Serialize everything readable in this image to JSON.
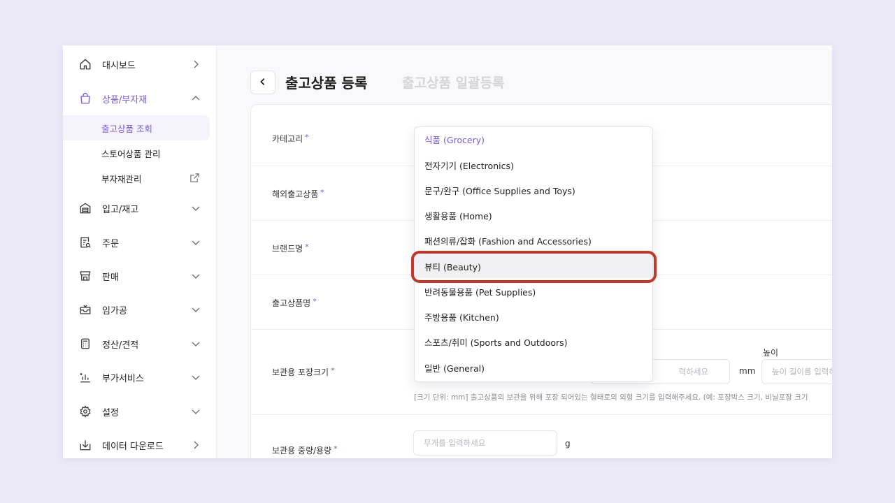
{
  "sidebar": {
    "items": [
      {
        "label": "대시보드"
      },
      {
        "label": "상품/부자재"
      },
      {
        "label": "입고/재고"
      },
      {
        "label": "주문"
      },
      {
        "label": "판매"
      },
      {
        "label": "임가공"
      },
      {
        "label": "정산/견적"
      },
      {
        "label": "부가서비스"
      },
      {
        "label": "설정"
      },
      {
        "label": "데이터 다운로드"
      }
    ],
    "sub_items": [
      {
        "label": "출고상품 조회"
      },
      {
        "label": "스토어상품 관리"
      },
      {
        "label": "부자재관리"
      }
    ]
  },
  "header": {
    "tab_active": "출고상품 등록",
    "tab_inactive": "출고상품 일괄등록"
  },
  "form": {
    "required_mark": "*",
    "category_label": "카테고리",
    "overseas_label": "해외출고상품",
    "brand_label": "브랜드명",
    "product_name_label": "출고상품명",
    "package_size_label": "보관용 포장크기",
    "height_label": "높이",
    "width_placeholder": "력하세요",
    "height_placeholder": "높이 길이를 입력하",
    "unit_mm": "mm",
    "size_hint": "[크기 단위: mm] 출고상품의 보관을 위해 포장 되어있는 형태로의 외형 크기를 입력해주세요. (예: 포장박스 크기, 비닐포장 크기",
    "weight_label": "보관용 중량/용량",
    "weight_placeholder": "무게를 입력하세요",
    "unit_g": "g"
  },
  "dropdown": {
    "options": [
      {
        "label": "식품 (Grocery)"
      },
      {
        "label": "전자기기 (Electronics)"
      },
      {
        "label": "문구/완구 (Office Supplies and Toys)"
      },
      {
        "label": "생활용품 (Home)"
      },
      {
        "label": "패션의류/잡화 (Fashion and Accessories)"
      },
      {
        "label": "뷰티 (Beauty)"
      },
      {
        "label": "반려동물용품 (Pet Supplies)"
      },
      {
        "label": "주방용품 (Kitchen)"
      },
      {
        "label": "스포츠/취미 (Sports and Outdoors)"
      },
      {
        "label": "일반 (General)"
      }
    ],
    "selected_index": 0,
    "highlighted_index": 5
  },
  "colors": {
    "accent": "#7a5bd6",
    "highlight_ring": "#c0392b",
    "background": "#eceaf8"
  }
}
